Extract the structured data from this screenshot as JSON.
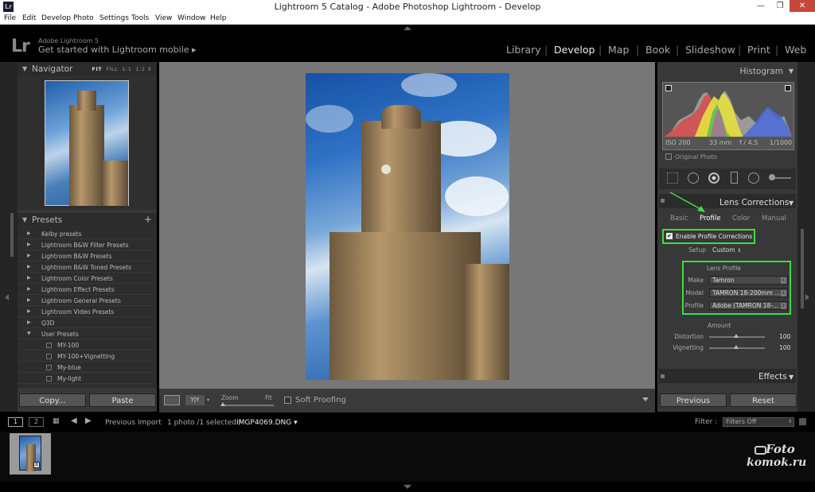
{
  "window": {
    "title": "Lightroom 5 Catalog - Adobe Photoshop Lightroom - Develop",
    "app_icon": "Lr",
    "min": "—",
    "max": "❐",
    "close": "✕"
  },
  "menu": [
    "File",
    "Edit",
    "Develop",
    "Photo",
    "Settings",
    "Tools",
    "View",
    "Window",
    "Help"
  ],
  "identity": {
    "logo": "Lr",
    "product": "Adobe Lightroom 5",
    "mobile": "Get started with Lightroom mobile ▸"
  },
  "modules": [
    "Library",
    "Develop",
    "Map",
    "Book",
    "Slideshow",
    "Print",
    "Web"
  ],
  "active_module": "Develop",
  "left": {
    "navigator": {
      "title": "Navigator",
      "opts": [
        "FIT",
        "FILL",
        "1:1",
        "1:2"
      ]
    },
    "presets": {
      "title": "Presets",
      "add": "+",
      "items": [
        "Kelby presets",
        "Lightroom B&W Filter Presets",
        "Lightroom B&W Presets",
        "Lightroom B&W Toned Presets",
        "Lightroom Color Presets",
        "Lightroom Effect Presets",
        "Lightroom General Presets",
        "Lightroom Video Presets",
        "Q3D",
        "User Presets"
      ],
      "user_items": [
        "MY-100",
        "MY-100+Vignetting",
        "My-blue",
        "My-light"
      ]
    },
    "copy": "Copy...",
    "paste": "Paste"
  },
  "toolbar": {
    "zoom": "Zoom",
    "fit": "Fit",
    "soft_proofing": "Soft Proofing",
    "yy": "Y|Y"
  },
  "right": {
    "histogram": {
      "title": "Histogram",
      "iso": "ISO 200",
      "focal": "33 mm",
      "aperture": "f / 4.5",
      "shutter": "1/1000",
      "original": "Original Photo"
    },
    "lens": {
      "title": "Lens Corrections",
      "tabs": [
        "Basic",
        "Profile",
        "Color",
        "Manual"
      ],
      "active_tab": "Profile",
      "enable": "Enable Profile Corrections",
      "setup_label": "Setup",
      "setup_value": "Custom",
      "lens_profile": "Lens Profile",
      "make_label": "Make",
      "make_value": "Tamron",
      "model_label": "Model",
      "model_value": "TAMRON 18-200mm ...",
      "profile_label": "Profile",
      "profile_value": "Adobe (TAMRON 18-...",
      "amount": "Amount",
      "distortion_label": "Distortion",
      "distortion_value": "100",
      "vignetting_label": "Vignetting",
      "vignetting_value": "100"
    },
    "effects": "Effects",
    "previous": "Previous",
    "reset": "Reset"
  },
  "filmstrip": {
    "view1": "1",
    "view2": "2",
    "source": "Previous Import",
    "count": "1 photo /1 selected /",
    "filename": "IMGP4069.DNG ▾",
    "filter_label": "Filter :",
    "filter_value": "Filters Off"
  },
  "watermark": {
    "line1": "Foto",
    "line2": "komok.ru"
  },
  "colors": {
    "accent_highlight": "#3ce03c",
    "panel": "#383838",
    "bg": "#000000"
  }
}
